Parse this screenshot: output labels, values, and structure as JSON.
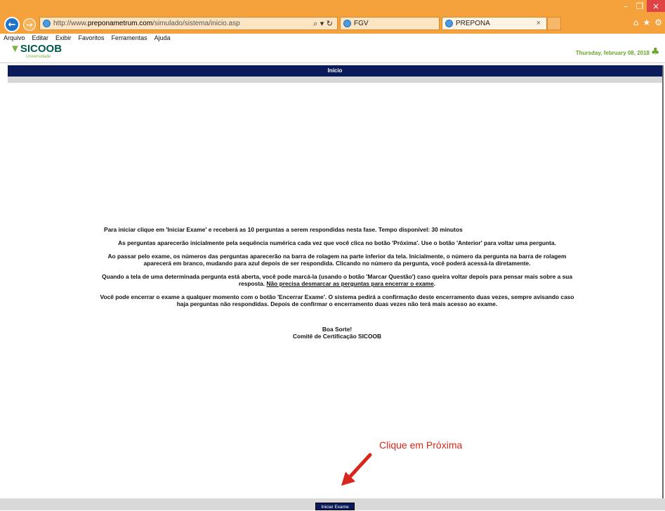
{
  "browser": {
    "url_prefix": "http://www.",
    "url_host": "preponametrum.com",
    "url_path": "/simulado/sistema/inicio.asp",
    "search_icon": "search-icon",
    "refresh_icon": "refresh-icon",
    "tabs": [
      {
        "label": "FGV"
      },
      {
        "label": "PREPONA",
        "close": "×"
      }
    ],
    "window_controls": {
      "minimize": "–",
      "restore": "❐",
      "close": "×"
    },
    "toolbar_icons": [
      "home-icon",
      "star-icon",
      "gear-icon"
    ]
  },
  "menu": {
    "items": [
      {
        "label": "Arquivo"
      },
      {
        "label": "Editar"
      },
      {
        "label": "Exibir"
      },
      {
        "label": "Favoritos"
      },
      {
        "label": "Ferramentas"
      },
      {
        "label": "Ajuda"
      }
    ]
  },
  "page": {
    "logo": "SICOOB",
    "logo_sub": "Universidade",
    "date": "Thursday, february 08, 2018",
    "header_title": "Início",
    "paragraphs": [
      "Para iniciar clique em 'Iniciar Exame' e receberá as 10 perguntas a serem respondidas nesta fase. Tempo disponível: 30 minutos",
      "As perguntas aparecerão inicialmente pela sequência numérica cada vez que você clica no botão 'Próxima'. Use o botão 'Anterior' para voltar uma pergunta.",
      "Ao passar pelo exame, os números das perguntas aparecerão na barra de rolagem na parte inferior da tela. Inicialmente, o número da pergunta na barra de rolagem aparecerá em branco, mudando para azul depois de ser respondida. Clicando no número da pergunta, você poderá acessá-la diretamente.",
      "Quando a tela de uma determinada pergunta está aberta, você pode marcá-la (usando o botão 'Marcar Questão') caso queira voltar depois para pensar mais sobre a sua resposta. ",
      "Você pode encerrar o exame a qualquer momento com o botão 'Encerrar Exame'. O sistema pedirá a confirmação deste encerramento duas vezes, sempre avisando caso haja perguntas não respondidas. Depois de confirmar o encerramento duas vezes não terá mais acesso ao exame."
    ],
    "underlined_note": "Não precisa desmarcar as perguntas para encerrar o exame",
    "note_suffix": ".",
    "sign_line1": "Boa Sorte!",
    "sign_line2": "Comitê de Certificação SICOOB",
    "callout": "Clique em Próxima",
    "start_button": "Iniciar Exame"
  }
}
